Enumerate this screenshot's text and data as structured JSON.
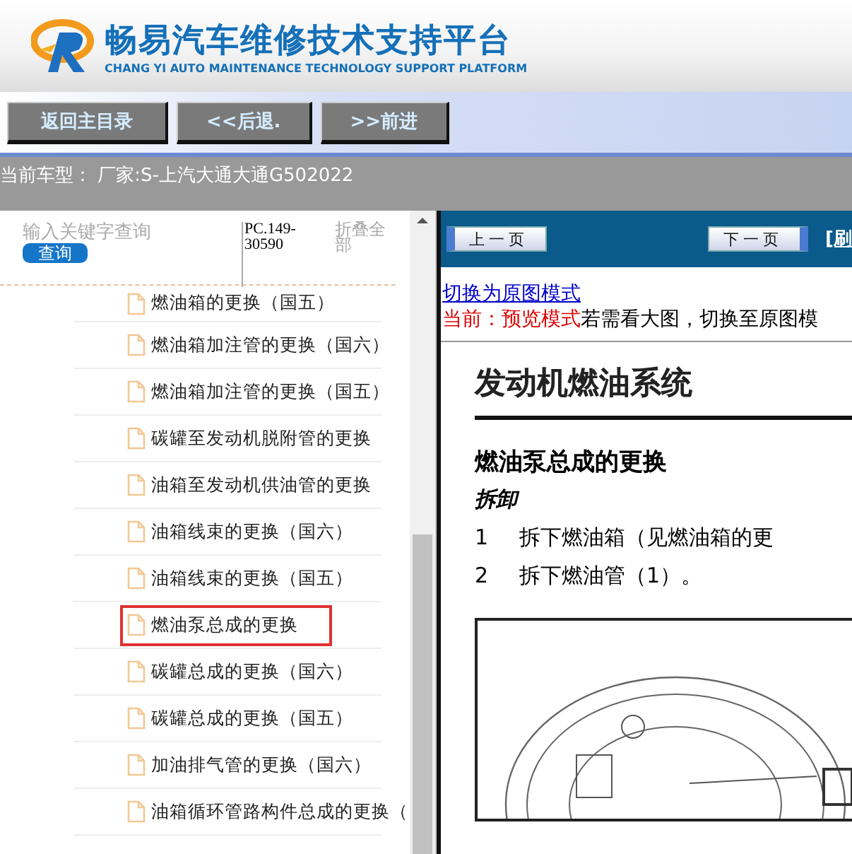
{
  "header": {
    "title": "畅易汽车维修技术支持平台",
    "subtitle": "CHANG YI AUTO MAINTENANCE TECHNOLOGY SUPPORT PLATFORM"
  },
  "nav_buttons": [
    "返回主目录",
    "<<后退.",
    ">>前进"
  ],
  "current_model": "当前车型： 厂家:S-上汽大通大通G502022",
  "sidebar": {
    "search": {
      "placeholder": "输入关键字查询"
    },
    "search_button": "查询",
    "code": "PC.149-30590",
    "collapse_all": "折叠全部",
    "items": [
      {
        "label": "燃油箱的更换（国五）",
        "selected": false
      },
      {
        "label": "燃油箱加注管的更换（国六）",
        "selected": false
      },
      {
        "label": "燃油箱加注管的更换（国五）",
        "selected": false
      },
      {
        "label": "碳罐至发动机脱附管的更换",
        "selected": false
      },
      {
        "label": "油箱至发动机供油管的更换",
        "selected": false
      },
      {
        "label": "油箱线束的更换（国六）",
        "selected": false
      },
      {
        "label": "油箱线束的更换（国五）",
        "selected": false
      },
      {
        "label": "燃油泵总成的更换",
        "selected": true
      },
      {
        "label": "碳罐总成的更换（国六）",
        "selected": false
      },
      {
        "label": "碳罐总成的更换（国五）",
        "selected": false
      },
      {
        "label": "加油排气管的更换（国六）",
        "selected": false
      },
      {
        "label": "油箱循环管路构件总成的更换（",
        "selected": false
      }
    ]
  },
  "viewer": {
    "prev_button": "上一页",
    "next_button": "下一页",
    "refresh_link": "[刷",
    "mode_link": "切换为原图模式",
    "mode_label": "当前：预览模式",
    "mode_hint": "若需看大图，切换至原图模",
    "document": {
      "section": "发动机燃油系统",
      "title": "燃油泵总成的更换",
      "subtitle": "拆卸",
      "steps": [
        {
          "number": "1",
          "text": "拆下燃油箱（见燃油箱的更"
        },
        {
          "number": "2",
          "text": "拆下燃油管（1）。"
        }
      ]
    }
  }
}
